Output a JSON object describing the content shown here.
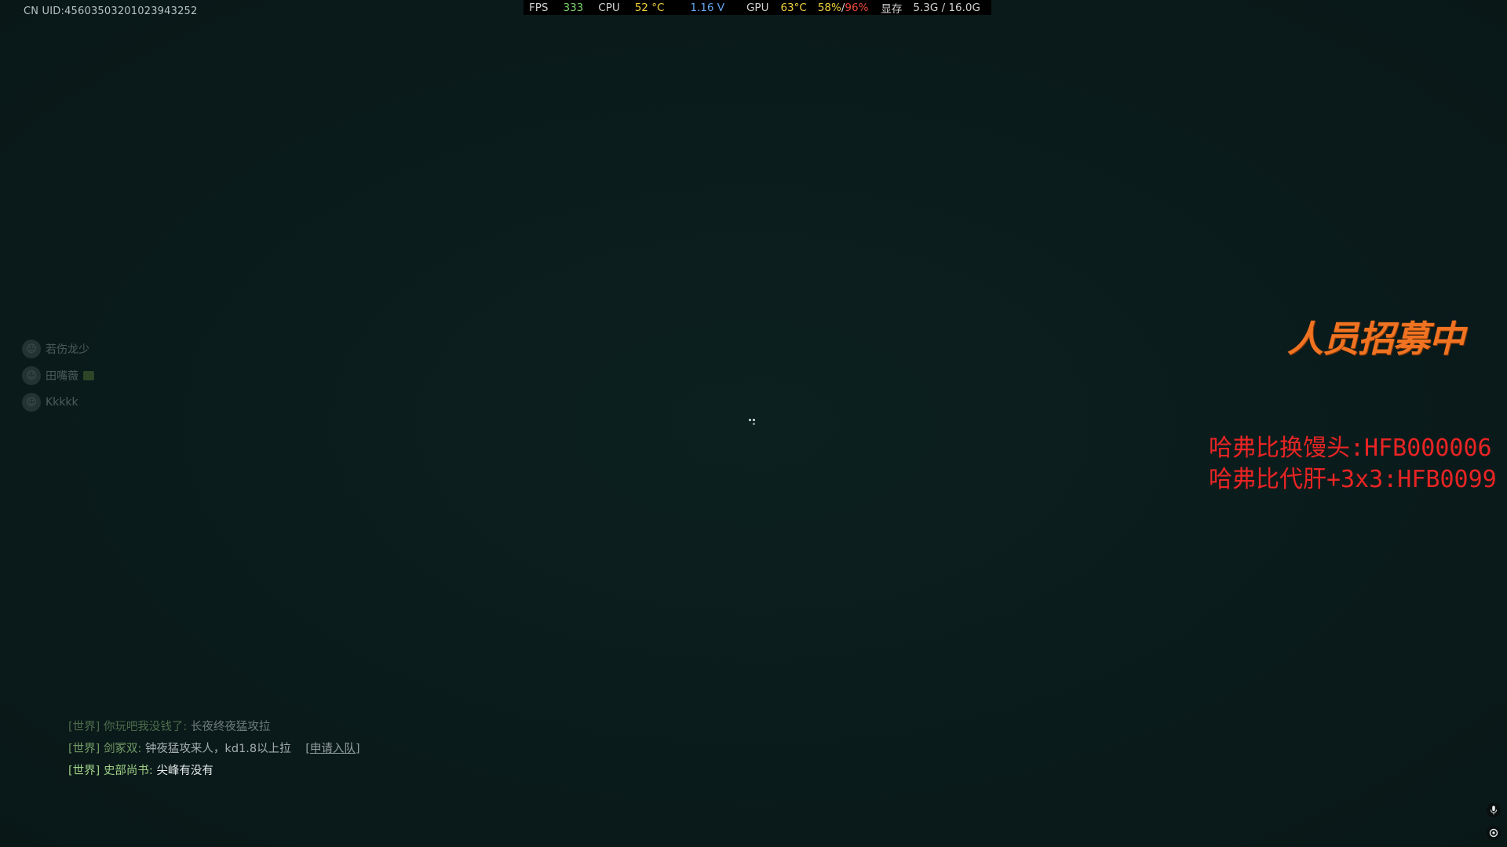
{
  "uid": "CN UID:4560350320102394325‌2",
  "perf": {
    "fps_label": "FPS",
    "fps_value": "333",
    "cpu_label": "CPU",
    "cpu_temp": "52 °C",
    "cpu_volt": "1.16 V",
    "gpu_label": "GPU",
    "gpu_temp": "63°C",
    "gpu_usage_a": "58%",
    "gpu_sep": "/",
    "gpu_usage_b": "96%",
    "vram_label": "显存",
    "vram_value": "5.3G / 16.0G"
  },
  "friends": [
    {
      "name": "若伤龙少"
    },
    {
      "name": "田嘴薇"
    },
    {
      "name": "Kkkkk"
    }
  ],
  "recruit": "人员招募中",
  "promo": {
    "line1": "哈弗比换馒头:HFB000006",
    "line2": "哈弗比代肝+3x3:HFB0099"
  },
  "chat": [
    {
      "channel": "[世界]",
      "sender": "你玩吧我没钱了:",
      "message": "长夜终夜猛攻拉",
      "action": ""
    },
    {
      "channel": "[世界]",
      "sender": "剑冢双:",
      "message": "钟夜猛攻来人，kd1.8以上拉",
      "action": "[申请入队]"
    },
    {
      "channel": "[世界]",
      "sender": "史部尚书:",
      "message": "尖峰有没有",
      "action": ""
    }
  ],
  "colors": {
    "background": "#0b1c1c",
    "recruit": "#f07322",
    "promo": "#e82424",
    "chat_channel": "#9ed088"
  },
  "icons": {
    "mic": "microphone-icon",
    "gear": "settings-icon",
    "loading": "loading-spinner-icon"
  }
}
